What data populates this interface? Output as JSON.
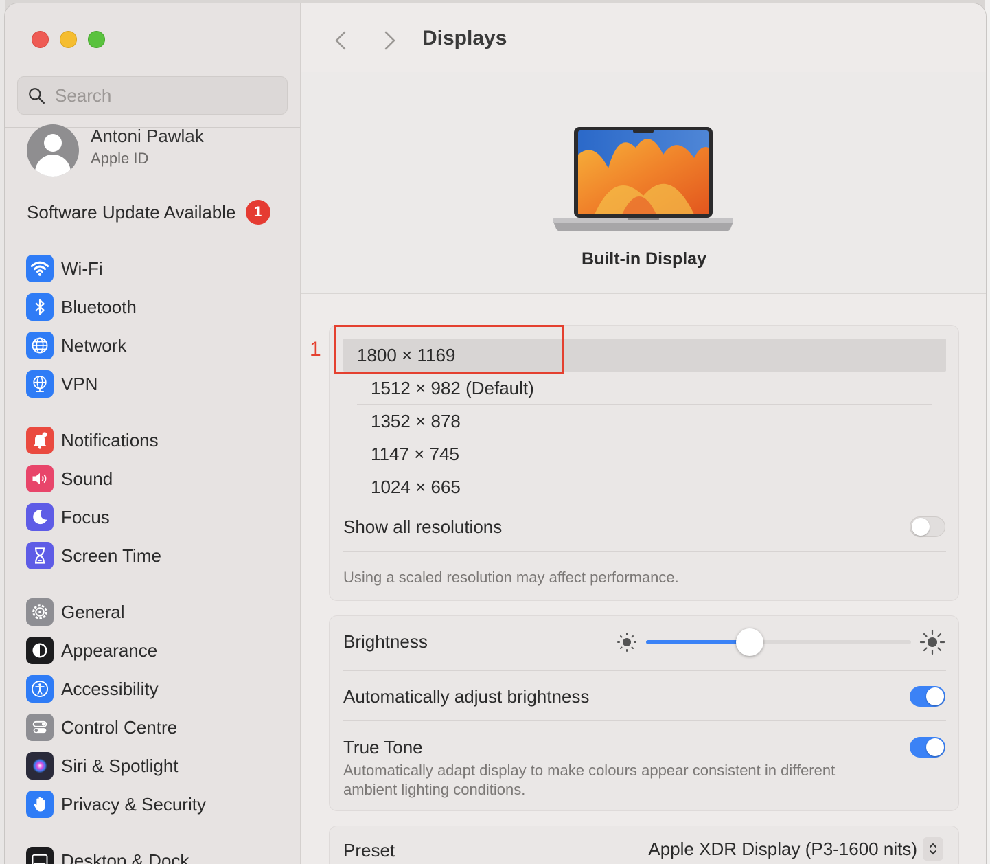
{
  "window": {
    "title": "Displays"
  },
  "search": {
    "placeholder": "Search"
  },
  "account": {
    "name": "Antoni Pawlak",
    "subtitle": "Apple ID"
  },
  "update": {
    "label": "Software Update Available",
    "badge": "1"
  },
  "sidebar": {
    "items": [
      {
        "label": "Wi-Fi",
        "icon": "wifi-icon",
        "color": "#2f7cf6"
      },
      {
        "label": "Bluetooth",
        "icon": "bluetooth-icon",
        "color": "#2f7cf6"
      },
      {
        "label": "Network",
        "icon": "globe-icon",
        "color": "#2f7cf6"
      },
      {
        "label": "VPN",
        "icon": "vpn-globe-icon",
        "color": "#2f7cf6"
      },
      {
        "label": "Notifications",
        "icon": "bell-icon",
        "color": "#ea4a3f"
      },
      {
        "label": "Sound",
        "icon": "speaker-icon",
        "color": "#e8456a"
      },
      {
        "label": "Focus",
        "icon": "moon-icon",
        "color": "#5e5ce6"
      },
      {
        "label": "Screen Time",
        "icon": "hourglass-icon",
        "color": "#5e5ce6"
      },
      {
        "label": "General",
        "icon": "gear-icon",
        "color": "#8e8e93"
      },
      {
        "label": "Appearance",
        "icon": "appearance-icon",
        "color": "#1c1c1e"
      },
      {
        "label": "Accessibility",
        "icon": "accessibility-icon",
        "color": "#2f7cf6"
      },
      {
        "label": "Control Centre",
        "icon": "control-centre-icon",
        "color": "#8e8e93"
      },
      {
        "label": "Siri & Spotlight",
        "icon": "siri-icon",
        "color": "#2a2a3a"
      },
      {
        "label": "Privacy & Security",
        "icon": "hand-icon",
        "color": "#2f7cf6"
      },
      {
        "label": "Desktop & Dock",
        "icon": "dock-icon",
        "color": "#1c1c1e"
      }
    ]
  },
  "hero": {
    "display_name": "Built-in Display"
  },
  "resolutions": {
    "options": [
      "1800 × 1169",
      "1512 × 982 (Default)",
      "1352 × 878",
      "1147 × 745",
      "1024 × 665"
    ],
    "selected": "1800 × 1169",
    "show_all_label": "Show all resolutions",
    "show_all_on": false,
    "note": "Using a scaled resolution may affect performance."
  },
  "brightness": {
    "label": "Brightness",
    "level": 0.39
  },
  "auto_brightness": {
    "label": "Automatically adjust brightness",
    "on": true
  },
  "true_tone": {
    "label": "True Tone",
    "description_line1": "Automatically adapt display to make colours appear consistent in different",
    "description_line2": "ambient lighting conditions.",
    "on": true
  },
  "preset": {
    "label": "Preset",
    "value": "Apple XDR Display (P3-1600 nits)"
  },
  "annotation": {
    "number": "1"
  },
  "colors": {
    "accent": "#3b82f6",
    "highlight": "#e4402f",
    "badge": "#e53b32"
  }
}
